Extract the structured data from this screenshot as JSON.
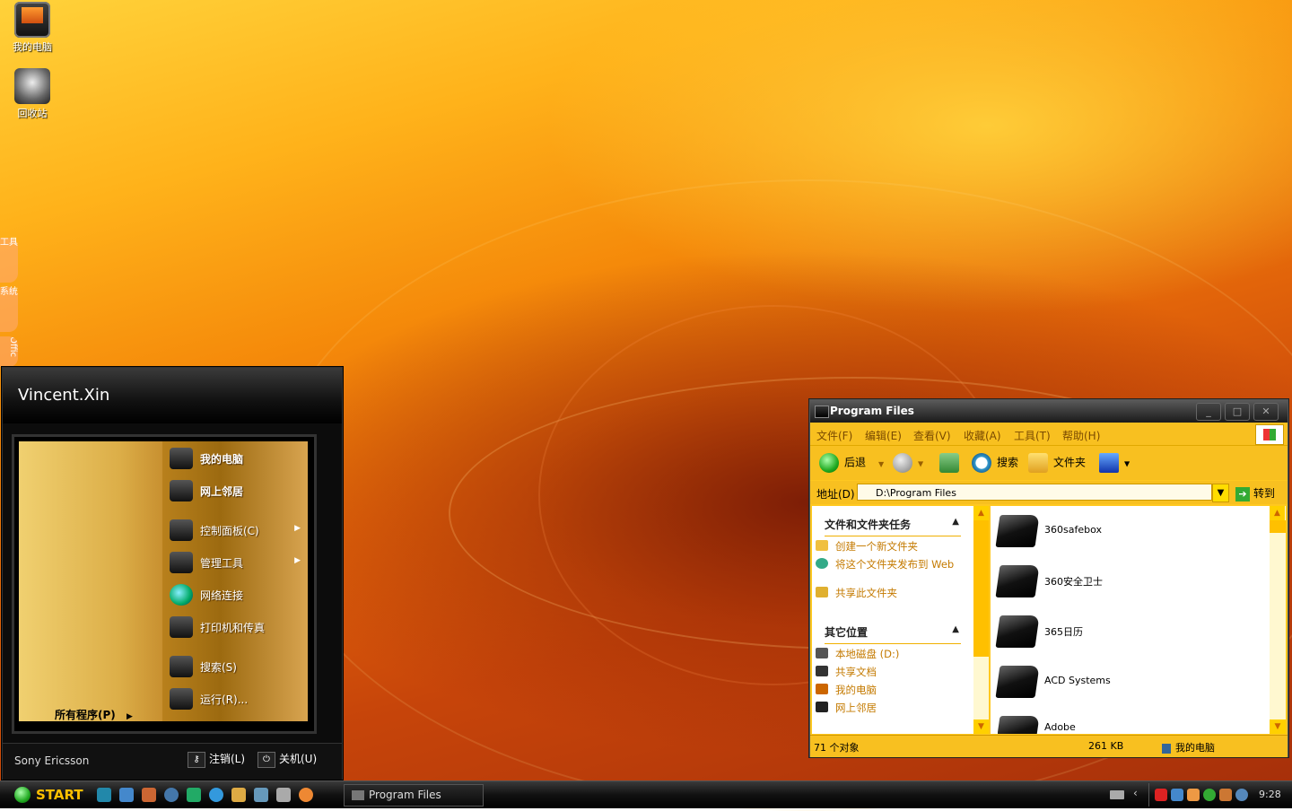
{
  "desktop": {
    "icons": [
      {
        "label": "我的电脑",
        "icon": "my-computer-icon"
      },
      {
        "label": "回收站",
        "icon": "recycle-bin-icon"
      }
    ],
    "side_tabs": [
      "工具",
      "系统",
      "Offic"
    ]
  },
  "start_menu": {
    "user": "Vincent.Xin",
    "items": [
      {
        "label": "我的电脑",
        "icon": "my-computer-icon",
        "bold": true
      },
      {
        "label": "网上邻居",
        "icon": "network-places-icon",
        "bold": true
      },
      {
        "label": "控制面板(C)",
        "icon": "control-panel-icon",
        "submenu": true
      },
      {
        "label": "管理工具",
        "icon": "admin-tools-icon",
        "submenu": true
      },
      {
        "label": "网络连接",
        "icon": "network-connections-icon"
      },
      {
        "label": "打印机和传真",
        "icon": "printer-icon"
      },
      {
        "label": "搜索(S)",
        "icon": "search-icon"
      },
      {
        "label": "运行(R)...",
        "icon": "run-icon"
      }
    ],
    "all_programs": "所有程序(P)",
    "brand": "Sony Ericsson",
    "logoff": "注销(L)",
    "shutdown": "关机(U)"
  },
  "explorer": {
    "title": "Program Files",
    "menu": [
      "文件(F)",
      "编辑(E)",
      "查看(V)",
      "收藏(A)",
      "工具(T)",
      "帮助(H)"
    ],
    "toolbar": {
      "back": "后退",
      "search": "搜索",
      "folders": "文件夹"
    },
    "address_label": "地址(D)",
    "address_value": "D:\\Program Files",
    "go_label": "转到",
    "task_panel": {
      "title": "文件和文件夹任务",
      "items": [
        "创建一个新文件夹",
        "将这个文件夹发布到 Web",
        "共享此文件夹"
      ]
    },
    "places_panel": {
      "title": "其它位置",
      "items": [
        "本地磁盘 (D:)",
        "共享文档",
        "我的电脑",
        "网上邻居"
      ]
    },
    "files": [
      "360safebox",
      "360安全卫士",
      "365日历",
      "ACD Systems",
      "Adobe"
    ],
    "status": {
      "count": "71 个对象",
      "size": "261 KB",
      "location": "我的电脑"
    }
  },
  "taskbar": {
    "start_label": "START",
    "task_button": "Program Files",
    "clock": "9:28"
  },
  "colors": {
    "accent": "#ffc820",
    "link": "#c47a00",
    "start_text": "#ffc000"
  }
}
